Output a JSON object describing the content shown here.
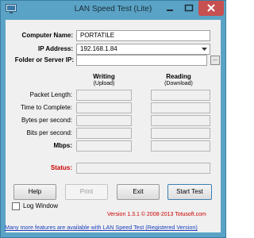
{
  "window": {
    "title": "LAN Speed Test (Lite)",
    "accent_color": "#5aa3c6",
    "close_color": "#c75050",
    "icons": [
      "app-icon",
      "minimize-icon",
      "maximize-icon",
      "close-icon"
    ]
  },
  "form": {
    "computer_name_label": "Computer Name:",
    "computer_name_value": "PORTATILE",
    "ip_address_label": "IP Address:",
    "ip_address_value": "192.168.1.84",
    "folder_label": "Folder or Server IP:",
    "folder_value": "",
    "browse_label": "..."
  },
  "results": {
    "writing_header": "Writing",
    "writing_sub": "(Upload)",
    "reading_header": "Reading",
    "reading_sub": "(Download)",
    "rows": [
      {
        "label": "Packet Length:",
        "bold": false
      },
      {
        "label": "Time to Complete:",
        "bold": false
      },
      {
        "label": "Bytes per second:",
        "bold": false
      },
      {
        "label": "Bits per second:",
        "bold": false
      },
      {
        "label": "Mbps:",
        "bold": true
      }
    ],
    "status_label": "Status:",
    "status_color": "#cc0000"
  },
  "buttons": {
    "help": "Help",
    "print": "Print",
    "exit": "Exit",
    "start": "Start Test"
  },
  "log_window": {
    "label": "Log Window",
    "checked": false
  },
  "footer": {
    "version": "Version 1.3.1 © 2008-2013 Totusoft.com",
    "promo": "Many more features are available with LAN Speed Test (Registered Version)"
  }
}
